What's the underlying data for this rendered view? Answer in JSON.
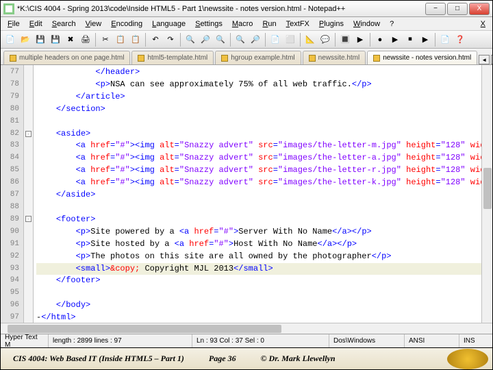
{
  "window": {
    "title": "*K:\\CIS 4004 - Spring 2013\\code\\Inside HTML5 - Part 1\\newssite - notes version.html - Notepad++",
    "buttons": {
      "min": "−",
      "max": "□",
      "close": "X"
    }
  },
  "menu": [
    "File",
    "Edit",
    "Search",
    "View",
    "Encoding",
    "Language",
    "Settings",
    "Macro",
    "Run",
    "TextFX",
    "Plugins",
    "Window",
    "?"
  ],
  "tabs": {
    "items": [
      {
        "label": "multiple headers on one page.html"
      },
      {
        "label": "html5-template.html"
      },
      {
        "label": "hgroup example.html"
      },
      {
        "label": "newssite.html"
      },
      {
        "label": "newssite - notes version.html"
      }
    ],
    "active": 4
  },
  "lines": [
    {
      "n": 77,
      "indent": 12,
      "parts": [
        {
          "t": "</header>",
          "c": "tag"
        }
      ]
    },
    {
      "n": 78,
      "indent": 12,
      "parts": [
        {
          "t": "<p>",
          "c": "tag"
        },
        {
          "t": "NSA can see approximately 75% of all web traffic."
        },
        {
          "t": "</p>",
          "c": "tag"
        }
      ]
    },
    {
      "n": 79,
      "indent": 8,
      "parts": [
        {
          "t": "</article>",
          "c": "tag"
        }
      ]
    },
    {
      "n": 80,
      "indent": 4,
      "parts": [
        {
          "t": "</section>",
          "c": "tag"
        }
      ]
    },
    {
      "n": 81,
      "indent": 0,
      "parts": []
    },
    {
      "n": 82,
      "indent": 4,
      "fold": "-",
      "parts": [
        {
          "t": "<aside>",
          "c": "tag"
        }
      ]
    },
    {
      "n": 83,
      "indent": 8,
      "parts": [
        {
          "t": "<a ",
          "c": "tag"
        },
        {
          "t": "href",
          "c": "attr"
        },
        {
          "t": "=",
          "c": "tag"
        },
        {
          "t": "\"#\"",
          "c": "str"
        },
        {
          "t": "><img ",
          "c": "tag"
        },
        {
          "t": "alt",
          "c": "attr"
        },
        {
          "t": "=",
          "c": "tag"
        },
        {
          "t": "\"Snazzy advert\"",
          "c": "str"
        },
        {
          "t": " ",
          "c": "tag"
        },
        {
          "t": "src",
          "c": "attr"
        },
        {
          "t": "=",
          "c": "tag"
        },
        {
          "t": "\"images/the-letter-m.jpg\"",
          "c": "str"
        },
        {
          "t": " ",
          "c": "tag"
        },
        {
          "t": "height",
          "c": "attr"
        },
        {
          "t": "=",
          "c": "tag"
        },
        {
          "t": "\"128\"",
          "c": "str"
        },
        {
          "t": " ",
          "c": "tag"
        },
        {
          "t": "wid",
          "c": "attr"
        }
      ]
    },
    {
      "n": 84,
      "indent": 8,
      "parts": [
        {
          "t": "<a ",
          "c": "tag"
        },
        {
          "t": "href",
          "c": "attr"
        },
        {
          "t": "=",
          "c": "tag"
        },
        {
          "t": "\"#\"",
          "c": "str"
        },
        {
          "t": "><img ",
          "c": "tag"
        },
        {
          "t": "alt",
          "c": "attr"
        },
        {
          "t": "=",
          "c": "tag"
        },
        {
          "t": "\"Snazzy advert\"",
          "c": "str"
        },
        {
          "t": " ",
          "c": "tag"
        },
        {
          "t": "src",
          "c": "attr"
        },
        {
          "t": "=",
          "c": "tag"
        },
        {
          "t": "\"images/the-letter-a.jpg\"",
          "c": "str"
        },
        {
          "t": " ",
          "c": "tag"
        },
        {
          "t": "height",
          "c": "attr"
        },
        {
          "t": "=",
          "c": "tag"
        },
        {
          "t": "\"128\"",
          "c": "str"
        },
        {
          "t": " ",
          "c": "tag"
        },
        {
          "t": "wid",
          "c": "attr"
        }
      ]
    },
    {
      "n": 85,
      "indent": 8,
      "parts": [
        {
          "t": "<a ",
          "c": "tag"
        },
        {
          "t": "href",
          "c": "attr"
        },
        {
          "t": "=",
          "c": "tag"
        },
        {
          "t": "\"#\"",
          "c": "str"
        },
        {
          "t": "><img ",
          "c": "tag"
        },
        {
          "t": "alt",
          "c": "attr"
        },
        {
          "t": "=",
          "c": "tag"
        },
        {
          "t": "\"Snazzy advert\"",
          "c": "str"
        },
        {
          "t": " ",
          "c": "tag"
        },
        {
          "t": "src",
          "c": "attr"
        },
        {
          "t": "=",
          "c": "tag"
        },
        {
          "t": "\"images/the-letter-r.jpg\"",
          "c": "str"
        },
        {
          "t": " ",
          "c": "tag"
        },
        {
          "t": "height",
          "c": "attr"
        },
        {
          "t": "=",
          "c": "tag"
        },
        {
          "t": "\"128\"",
          "c": "str"
        },
        {
          "t": " ",
          "c": "tag"
        },
        {
          "t": "wid",
          "c": "attr"
        }
      ]
    },
    {
      "n": 86,
      "indent": 8,
      "parts": [
        {
          "t": "<a ",
          "c": "tag"
        },
        {
          "t": "href",
          "c": "attr"
        },
        {
          "t": "=",
          "c": "tag"
        },
        {
          "t": "\"#\"",
          "c": "str"
        },
        {
          "t": "><img ",
          "c": "tag"
        },
        {
          "t": "alt",
          "c": "attr"
        },
        {
          "t": "=",
          "c": "tag"
        },
        {
          "t": "\"Snazzy advert\"",
          "c": "str"
        },
        {
          "t": " ",
          "c": "tag"
        },
        {
          "t": "src",
          "c": "attr"
        },
        {
          "t": "=",
          "c": "tag"
        },
        {
          "t": "\"images/the-letter-k.jpg\"",
          "c": "str"
        },
        {
          "t": " ",
          "c": "tag"
        },
        {
          "t": "height",
          "c": "attr"
        },
        {
          "t": "=",
          "c": "tag"
        },
        {
          "t": "\"128\"",
          "c": "str"
        },
        {
          "t": " ",
          "c": "tag"
        },
        {
          "t": "wid",
          "c": "attr"
        }
      ]
    },
    {
      "n": 87,
      "indent": 4,
      "parts": [
        {
          "t": "</aside>",
          "c": "tag"
        }
      ]
    },
    {
      "n": 88,
      "indent": 0,
      "parts": []
    },
    {
      "n": 89,
      "indent": 4,
      "fold": "-",
      "parts": [
        {
          "t": "<footer>",
          "c": "tag"
        }
      ]
    },
    {
      "n": 90,
      "indent": 8,
      "parts": [
        {
          "t": "<p>",
          "c": "tag"
        },
        {
          "t": "Site powered by a "
        },
        {
          "t": "<a ",
          "c": "tag"
        },
        {
          "t": "href",
          "c": "attr"
        },
        {
          "t": "=",
          "c": "tag"
        },
        {
          "t": "\"#\"",
          "c": "str"
        },
        {
          "t": ">",
          "c": "tag"
        },
        {
          "t": "Server With No Name"
        },
        {
          "t": "</a></p>",
          "c": "tag"
        }
      ]
    },
    {
      "n": 91,
      "indent": 8,
      "parts": [
        {
          "t": "<p>",
          "c": "tag"
        },
        {
          "t": "Site hosted by a "
        },
        {
          "t": "<a ",
          "c": "tag"
        },
        {
          "t": "href",
          "c": "attr"
        },
        {
          "t": "=",
          "c": "tag"
        },
        {
          "t": "\"#\"",
          "c": "str"
        },
        {
          "t": ">",
          "c": "tag"
        },
        {
          "t": "Host With No Name"
        },
        {
          "t": "</a></p>",
          "c": "tag"
        }
      ]
    },
    {
      "n": 92,
      "indent": 8,
      "parts": [
        {
          "t": "<p>",
          "c": "tag"
        },
        {
          "t": "The photos on this site are all owned by the photographer"
        },
        {
          "t": "</p>",
          "c": "tag"
        }
      ]
    },
    {
      "n": 93,
      "indent": 8,
      "hl": true,
      "parts": [
        {
          "t": "<small>",
          "c": "tag"
        },
        {
          "t": "&copy;",
          "c": "ent"
        },
        {
          "t": " Copyright MJL 2013"
        },
        {
          "t": "</small>",
          "c": "tag"
        }
      ]
    },
    {
      "n": 94,
      "indent": 4,
      "parts": [
        {
          "t": "</footer>",
          "c": "tag"
        }
      ]
    },
    {
      "n": 95,
      "indent": 0,
      "parts": []
    },
    {
      "n": 96,
      "indent": 4,
      "parts": [
        {
          "t": "</body>",
          "c": "tag"
        }
      ]
    },
    {
      "n": 97,
      "indent": 0,
      "parts": [
        {
          "t": "-"
        },
        {
          "t": "</html>",
          "c": "tag"
        }
      ]
    }
  ],
  "status": {
    "lang": "Hyper Text M",
    "length": "length : 2899    lines : 97",
    "pos": "Ln : 93    Col : 37    Sel : 0",
    "eol": "Dos\\Windows",
    "enc": "ANSI",
    "mode": "INS"
  },
  "footer": {
    "course": "CIS 4004: Web Based IT (Inside HTML5 – Part 1)",
    "page": "Page 36",
    "author": "© Dr. Mark Llewellyn"
  },
  "toolbar_icons": [
    "📄",
    "📂",
    "💾",
    "💾",
    "✖",
    "🖨",
    "|",
    "✂",
    "📋",
    "📋",
    "|",
    "↶",
    "↷",
    "|",
    "🔍",
    "🔎",
    "🔍",
    "|",
    "🔍",
    "🔎",
    "|",
    "📄",
    "⬜",
    "|",
    "📐",
    "💬",
    "|",
    "🔳",
    "▶",
    "|",
    "●",
    "▶",
    "⏹",
    "▶",
    "|",
    "📄",
    "❓"
  ]
}
